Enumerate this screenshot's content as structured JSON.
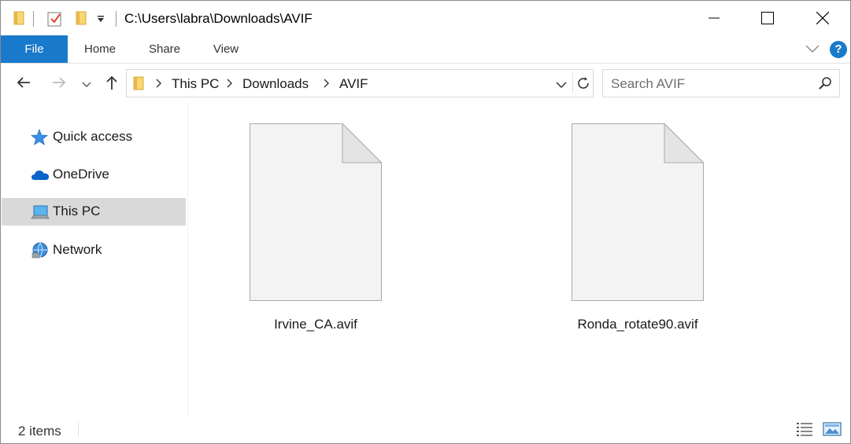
{
  "window": {
    "title": "C:\\Users\\labra\\Downloads\\AVIF"
  },
  "ribbon": {
    "tabs": [
      {
        "label": "File"
      },
      {
        "label": "Home"
      },
      {
        "label": "Share"
      },
      {
        "label": "View"
      }
    ],
    "help_label": "?"
  },
  "address": {
    "crumbs": [
      "This PC",
      "Downloads",
      "AVIF"
    ]
  },
  "search": {
    "placeholder": "Search AVIF"
  },
  "sidebar": {
    "items": [
      {
        "label": "Quick access",
        "icon": "star-icon"
      },
      {
        "label": "OneDrive",
        "icon": "cloud-icon"
      },
      {
        "label": "This PC",
        "icon": "computer-icon",
        "selected": true
      },
      {
        "label": "Network",
        "icon": "network-icon"
      }
    ]
  },
  "files": [
    {
      "name": "Irvine_CA.avif",
      "icon": "generic-file-icon"
    },
    {
      "name": "Ronda_rotate90.avif",
      "icon": "generic-file-icon"
    }
  ],
  "status": {
    "item_count": "2 items"
  },
  "colors": {
    "accent": "#1979ca",
    "selected_bg": "#d9d9d9",
    "folder": "#f8d775"
  }
}
